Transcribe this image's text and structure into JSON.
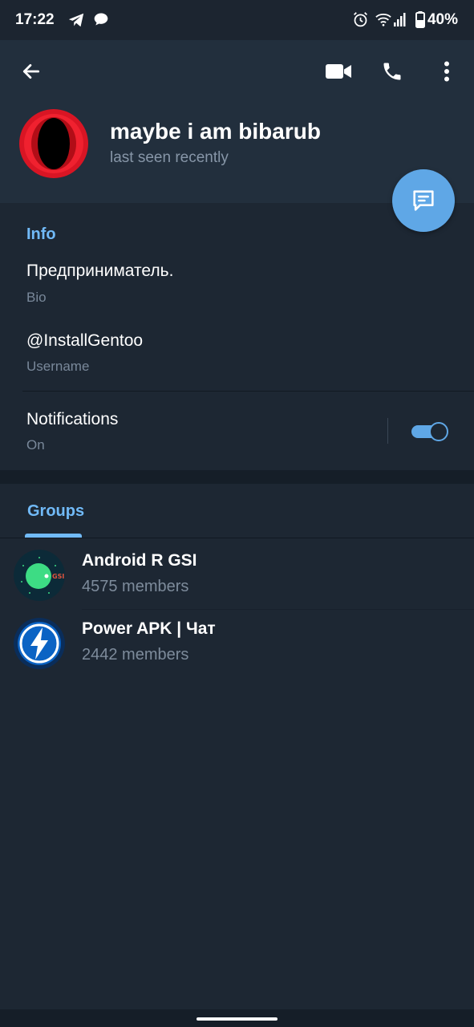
{
  "status_bar": {
    "time": "17:22",
    "battery": "40%"
  },
  "header": {
    "name": "maybe i am bibarub",
    "status": "last seen recently"
  },
  "info": {
    "section_title": "Info",
    "bio": {
      "value": "Предприниматель.",
      "label": "Bio"
    },
    "username": {
      "value": "@InstallGentoo",
      "label": "Username"
    },
    "notifications": {
      "title": "Notifications",
      "state": "On",
      "enabled": true
    }
  },
  "groups": {
    "tab_label": "Groups",
    "items": [
      {
        "name": "Android R GSI",
        "members": "4575 members",
        "avatar_badge": "GSI",
        "icon": "android-gsi-avatar"
      },
      {
        "name": "Power APK | Чат",
        "members": "2442 members",
        "icon": "lightning-avatar"
      }
    ]
  },
  "colors": {
    "background": "#1d2733",
    "header": "#222f3d",
    "accent": "#71baf8",
    "fab": "#5fa7e6",
    "toggle": "#5fa7e6"
  }
}
